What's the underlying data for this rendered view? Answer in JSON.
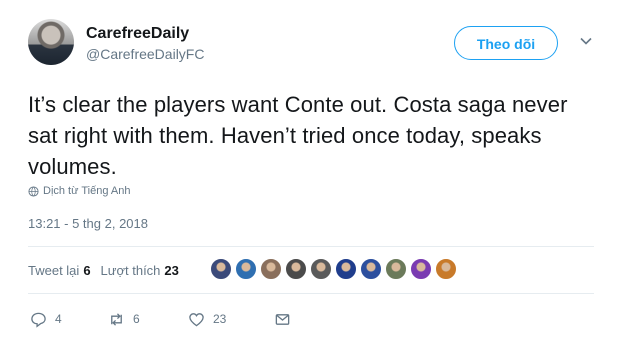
{
  "user": {
    "display_name": "CarefreeDaily",
    "handle": "@CarefreeDailyFC"
  },
  "follow_label": "Theo dõi",
  "tweet": {
    "text": "It’s clear the players want Conte out. Costa saga never sat right with them. Haven’t tried once today, speaks volumes.",
    "translate_label": "Dịch từ Tiếng Anh",
    "timestamp": "13:21 - 5 thg 2, 2018"
  },
  "stats": {
    "retweets_label": "Tweet lại",
    "retweets_count": "6",
    "likes_label": "Lượt thích",
    "likes_count": "23"
  },
  "liker_avatar_colors": [
    "#3b4a7a",
    "#2f6fb1",
    "#8a6f5c",
    "#4b4b4b",
    "#5a5a5a",
    "#1f3d8c",
    "#2c4f9e",
    "#6b7a5a",
    "#7a3bb1",
    "#c87a2a"
  ],
  "actions": {
    "reply_count": "4",
    "retweet_count": "6",
    "like_count": "23"
  },
  "colors": {
    "accent": "#1da1f2",
    "muted": "#657786",
    "text": "#14171a"
  }
}
